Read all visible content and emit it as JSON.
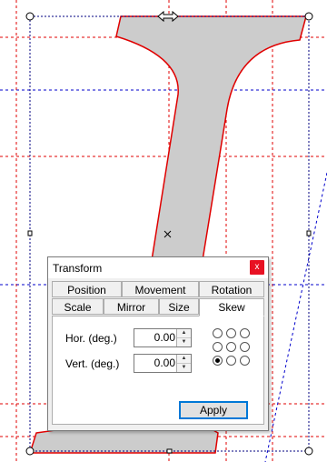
{
  "dialog": {
    "title": "Transform",
    "close_label": "x",
    "tabs_row1": [
      "Position",
      "Movement",
      "Rotation"
    ],
    "tabs_row2": [
      "Scale",
      "Mirror",
      "Size",
      "Skew"
    ],
    "active_tab": "Skew",
    "fields": [
      {
        "label": "Hor. (deg.)",
        "value": "0.00"
      },
      {
        "label": "Vert. (deg.)",
        "value": "0.00"
      }
    ],
    "anchor_grid": {
      "rows": 3,
      "cols": 3,
      "selected": [
        2,
        0
      ]
    },
    "apply_label": "Apply"
  },
  "colors": {
    "shape_fill": "#cccccc",
    "shape_outline": "#e00000",
    "guide_red": "#e00000",
    "guide_blue": "#0000cc",
    "accent": "#0078d7"
  }
}
